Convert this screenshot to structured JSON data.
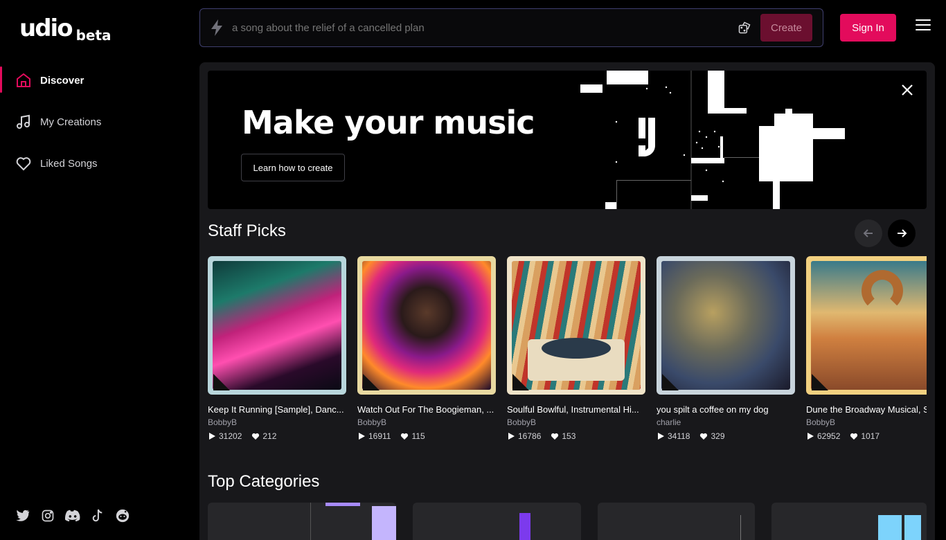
{
  "app": {
    "logo": "udio",
    "badge": "beta"
  },
  "sidebar": {
    "items": [
      {
        "label": "Discover",
        "icon": "home-icon"
      },
      {
        "label": "My Creations",
        "icon": "music-note-icon"
      },
      {
        "label": "Liked Songs",
        "icon": "heart-icon"
      }
    ],
    "socials": [
      "twitter-icon",
      "instagram-icon",
      "discord-icon",
      "tiktok-icon",
      "reddit-icon"
    ]
  },
  "topbar": {
    "search_placeholder": "a song about the relief of a cancelled plan",
    "create_label": "Create",
    "signin_label": "Sign In"
  },
  "hero": {
    "title": "Make your music",
    "button_label": "Learn how to create"
  },
  "staff_picks": {
    "title": "Staff Picks",
    "tracks": [
      {
        "title": "Keep It Running [Sample], Danc...",
        "artist": "BobbyB",
        "plays": "31202",
        "likes": "212"
      },
      {
        "title": "Watch Out For The Boogieman, ...",
        "artist": "BobbyB",
        "plays": "16911",
        "likes": "115"
      },
      {
        "title": "Soulful Bowlful, Instrumental Hi...",
        "artist": "BobbyB",
        "plays": "16786",
        "likes": "153"
      },
      {
        "title": "you spilt a coffee on my dog",
        "artist": "charlie",
        "plays": "34118",
        "likes": "329"
      },
      {
        "title": "Dune the Broadway Musical, S",
        "artist": "BobbyB",
        "plays": "62952",
        "likes": "1017"
      }
    ]
  },
  "top_categories": {
    "title": "Top Categories"
  },
  "colors": {
    "accent": "#e30b5c",
    "panel": "#18181b",
    "background": "#000000"
  }
}
